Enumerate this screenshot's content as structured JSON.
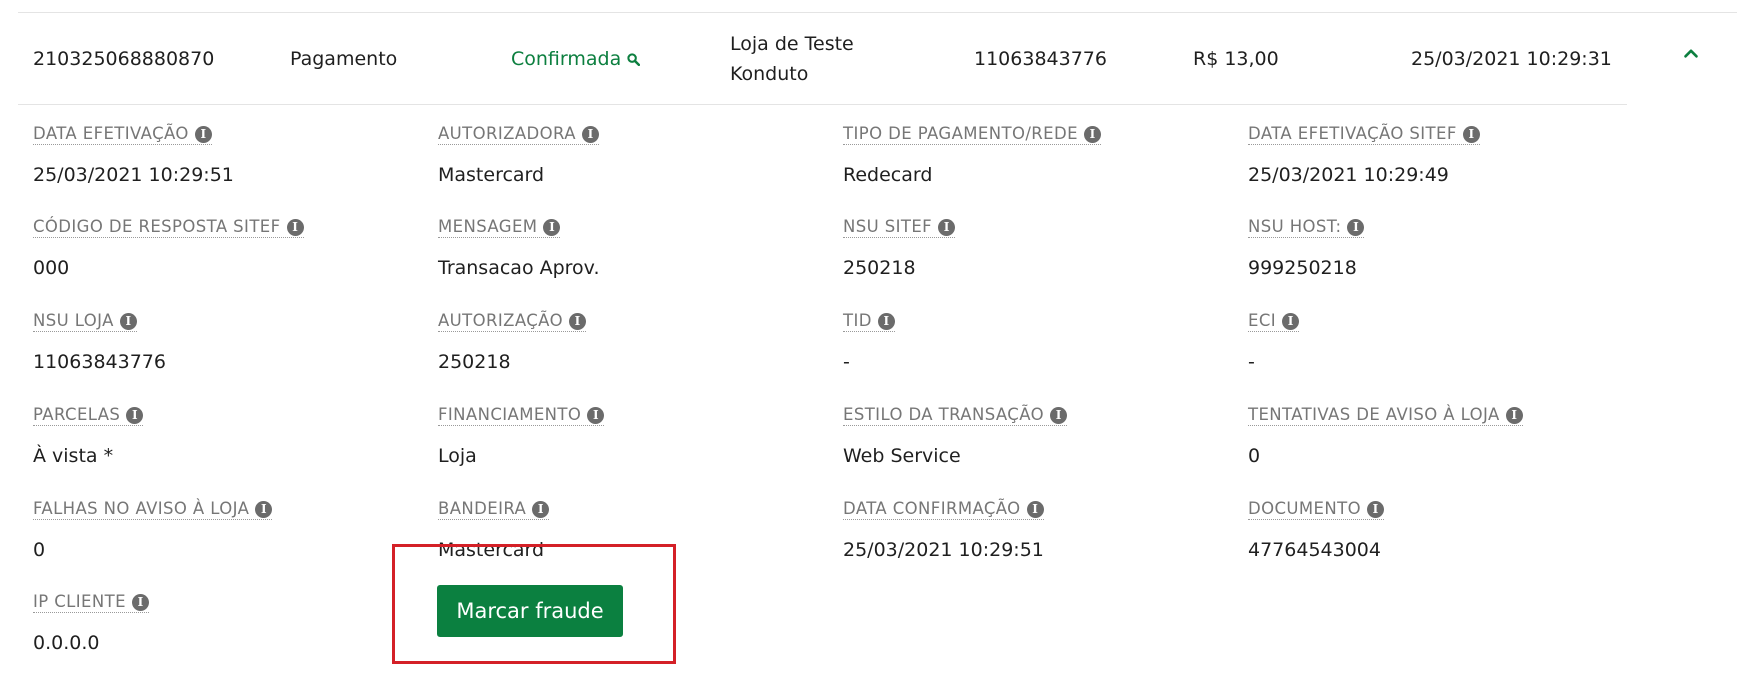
{
  "summary": {
    "id": "210325068880870",
    "type": "Pagamento",
    "status": "Confirmada",
    "store_line1": "Loja de Teste",
    "store_line2": "Konduto",
    "order": "11063843776",
    "amount": "R$ 13,00",
    "datetime": "25/03/2021 10:29:31",
    "status_color": "#0c7f3f",
    "collapse_icon": "chevron-up-icon",
    "status_icon": "search-icon"
  },
  "fields": [
    {
      "label": "DATA EFETIVAÇÃO",
      "value": "25/03/2021 10:29:51"
    },
    {
      "label": "AUTORIZADORA",
      "value": "Mastercard"
    },
    {
      "label": "TIPO DE PAGAMENTO/REDE",
      "value": "Redecard"
    },
    {
      "label": "DATA EFETIVAÇÃO SITEF",
      "value": "25/03/2021 10:29:49"
    },
    {
      "label": "CÓDIGO DE RESPOSTA SITEF",
      "value": "000"
    },
    {
      "label": "MENSAGEM",
      "value": "Transacao Aprov."
    },
    {
      "label": "NSU SITEF",
      "value": "250218"
    },
    {
      "label": "NSU HOST:",
      "value": "999250218"
    },
    {
      "label": "NSU LOJA",
      "value": "11063843776"
    },
    {
      "label": "AUTORIZAÇÃO",
      "value": "250218"
    },
    {
      "label": "TID",
      "value": "-"
    },
    {
      "label": "ECI",
      "value": "-"
    },
    {
      "label": "PARCELAS",
      "value": "À vista *"
    },
    {
      "label": "FINANCIAMENTO",
      "value": "Loja"
    },
    {
      "label": "ESTILO DA TRANSAÇÃO",
      "value": "Web Service"
    },
    {
      "label": "TENTATIVAS DE AVISO À LOJA",
      "value": "0"
    },
    {
      "label": "FALHAS NO AVISO À LOJA",
      "value": "0"
    },
    {
      "label": "BANDEIRA",
      "value": "Mastercard"
    },
    {
      "label": "DATA CONFIRMAÇÃO",
      "value": "25/03/2021 10:29:51"
    },
    {
      "label": "DOCUMENTO",
      "value": "47764543004"
    },
    {
      "label": "IP CLIENTE",
      "value": "0.0.0.0"
    }
  ],
  "actions": {
    "mark_fraud_label": "Marcar fraude",
    "button_color": "#0b8040",
    "highlight_color": "#d42027"
  },
  "info_glyph": "i"
}
